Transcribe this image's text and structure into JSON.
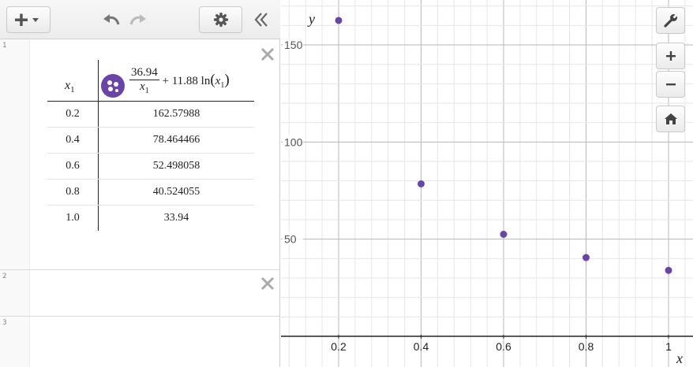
{
  "toolbar": {
    "add_icon": "plus-dropdown-icon",
    "undo_icon": "undo-icon",
    "redo_icon": "redo-icon",
    "settings_icon": "gear-icon",
    "collapse_icon": "double-chevron-left-icon"
  },
  "expressions": [
    {
      "index": "1",
      "type": "table",
      "column_x_header": "x",
      "column_x_subscript": "1",
      "column_y_formula": {
        "numerator": "36.94",
        "denominator_var": "x",
        "denominator_sub": "1",
        "rest": "+ 11.88 ln",
        "arg_var": "x",
        "arg_sub": "1"
      },
      "rows": [
        {
          "x": "0.2",
          "y": "162.57988"
        },
        {
          "x": "0.4",
          "y": "78.464466"
        },
        {
          "x": "0.6",
          "y": "52.498058"
        },
        {
          "x": "0.8",
          "y": "40.524055"
        },
        {
          "x": "1.0",
          "y": "33.94"
        }
      ],
      "point_color": "#6b44a8"
    },
    {
      "index": "2",
      "type": "empty"
    },
    {
      "index": "3",
      "type": "empty"
    }
  ],
  "graph_controls": [
    "wrench-icon",
    "zoom-in-icon",
    "zoom-out-icon",
    "home-icon"
  ],
  "chart_data": {
    "type": "scatter",
    "x": [
      0.2,
      0.4,
      0.6,
      0.8,
      1.0
    ],
    "y": [
      162.57988,
      78.464466,
      52.498058,
      40.524055,
      33.94
    ],
    "xlabel": "x",
    "ylabel": "y",
    "x_ticks": [
      "0.2",
      "0.4",
      "0.6",
      "0.8",
      "1"
    ],
    "y_ticks": [
      "50",
      "100",
      "150"
    ],
    "grid": true,
    "color": "#6b44a8"
  }
}
